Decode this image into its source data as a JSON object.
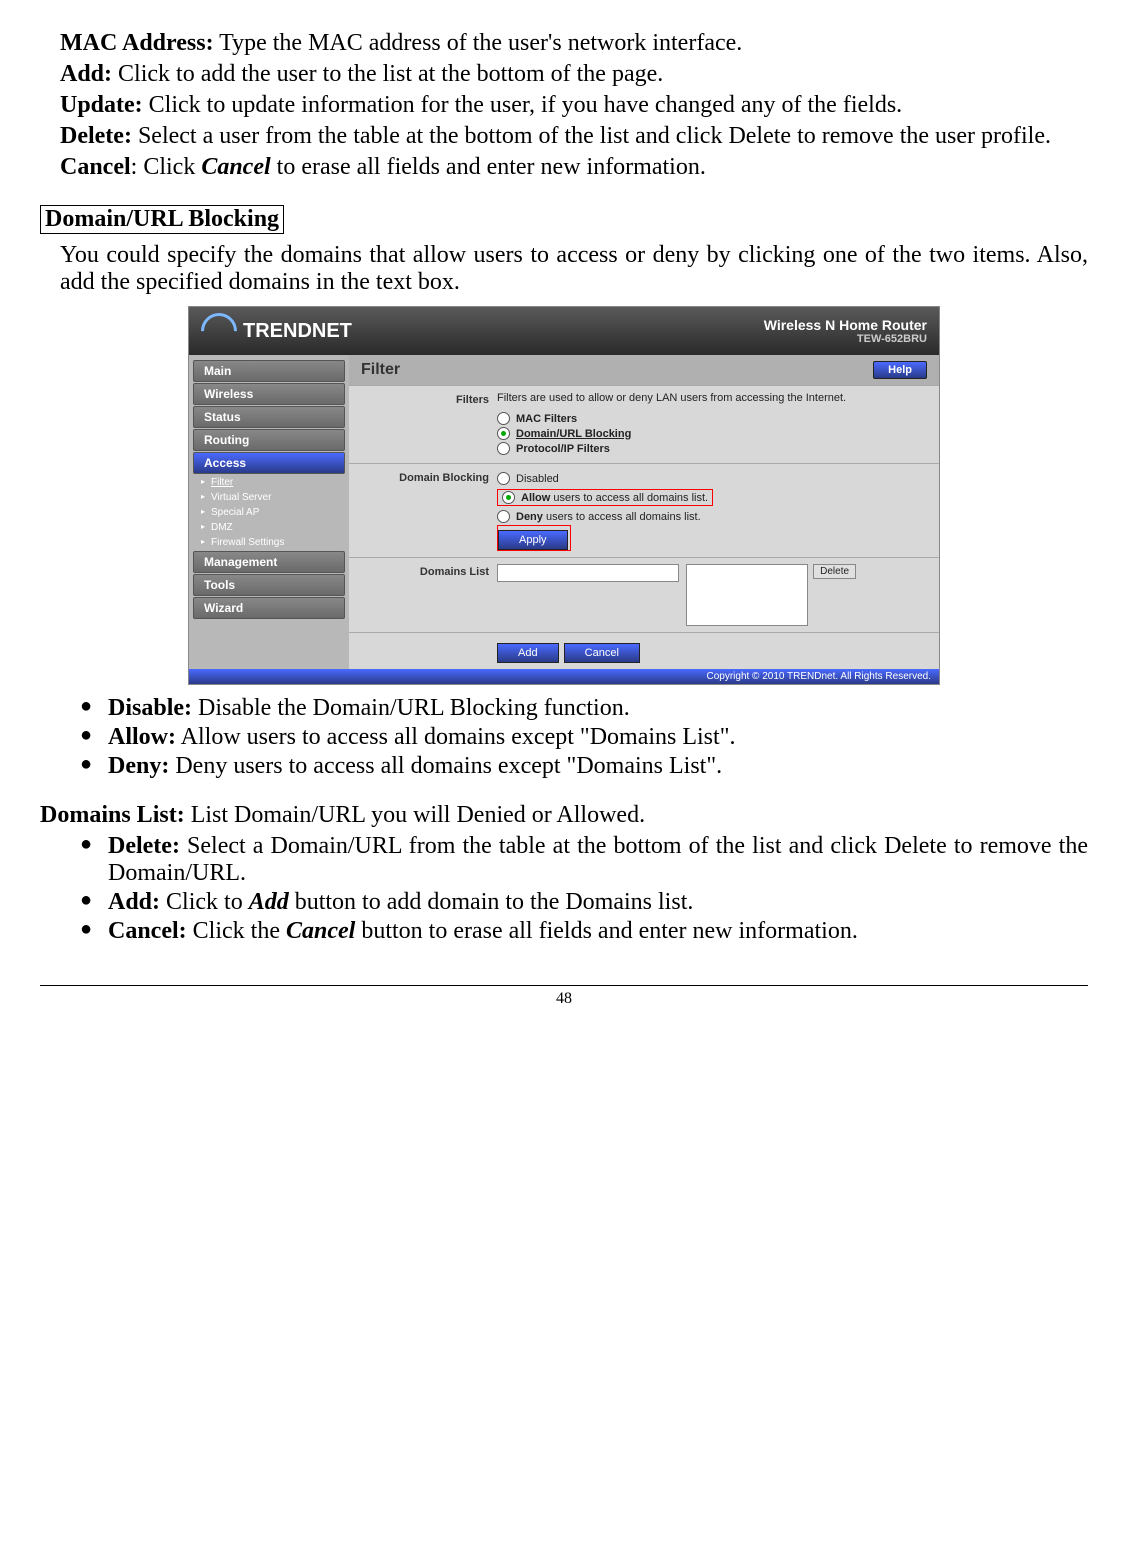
{
  "defs": {
    "mac": {
      "label": "MAC Address:",
      "text": " Type the MAC address of the user's network interface."
    },
    "add": {
      "label": "Add:",
      "text": " Click to add the user to the list at the bottom of the page."
    },
    "update": {
      "label": "Update:",
      "text": " Click to update information for the user, if you have changed any of the fields."
    },
    "delete": {
      "label": "Delete:",
      "text": " Select a user from the table at the bottom of the list and click Delete to remove the user profile."
    },
    "cancel": {
      "label": "Cancel",
      "colon": ": Click ",
      "action": "Cancel",
      "tail": " to erase all fields and enter new information."
    }
  },
  "section_header": "Domain/URL Blocking",
  "section_intro": "You could specify the domains that allow users to access or deny by clicking one of the two items.  Also, add the specified domains in the text box.",
  "screenshot": {
    "brand": "TRENDNET",
    "product_title": "Wireless N Home Router",
    "model": "TEW-652BRU",
    "sidebar": {
      "items": [
        "Main",
        "Wireless",
        "Status",
        "Routing",
        "Access",
        "Management",
        "Tools",
        "Wizard"
      ],
      "sub": [
        "Filter",
        "Virtual Server",
        "Special AP",
        "DMZ",
        "Firewall Settings"
      ]
    },
    "page_title": "Filter",
    "help": "Help",
    "filters": {
      "label": "Filters",
      "desc": "Filters are used to allow or deny LAN users from accessing the Internet.",
      "opts": [
        "MAC Filters",
        "Domain/URL Blocking",
        "Protocol/IP Filters"
      ]
    },
    "domain_blocking": {
      "label": "Domain Blocking",
      "opts": {
        "disabled": "Disabled",
        "allow_b": "Allow",
        "allow_t": " users to access all domains list.",
        "deny_b": "Deny",
        "deny_t": " users to access all domains list."
      },
      "apply": "Apply"
    },
    "domains_list": {
      "label": "Domains List",
      "delete": "Delete"
    },
    "bottom": {
      "add": "Add",
      "cancel": "Cancel"
    },
    "footer": "Copyright © 2010 TRENDnet. All Rights Reserved."
  },
  "bullets1": {
    "disable": {
      "label": "Disable:",
      "text": " Disable the Domain/URL Blocking function."
    },
    "allow": {
      "label": "Allow:",
      "text": " Allow users to access all domains except \"Domains List\"."
    },
    "deny": {
      "label": "Deny:",
      "text": " Deny users to access all domains except \"Domains List\"."
    }
  },
  "domains_list_heading": {
    "label": "Domains List:",
    "text": " List Domain/URL you will Denied or Allowed."
  },
  "bullets2": {
    "delete": {
      "label": "Delete:",
      "text": " Select a Domain/URL from the table at the bottom of the list and click Delete to remove the Domain/URL."
    },
    "add": {
      "label": "Add:",
      "pre": " Click to ",
      "action": "Add",
      "post": " button to add domain to the Domains list."
    },
    "cancel": {
      "label": "Cancel:",
      "pre": " Click the ",
      "action": "Cancel",
      "post": " button to erase all fields and enter new information."
    }
  },
  "page_number": "48"
}
